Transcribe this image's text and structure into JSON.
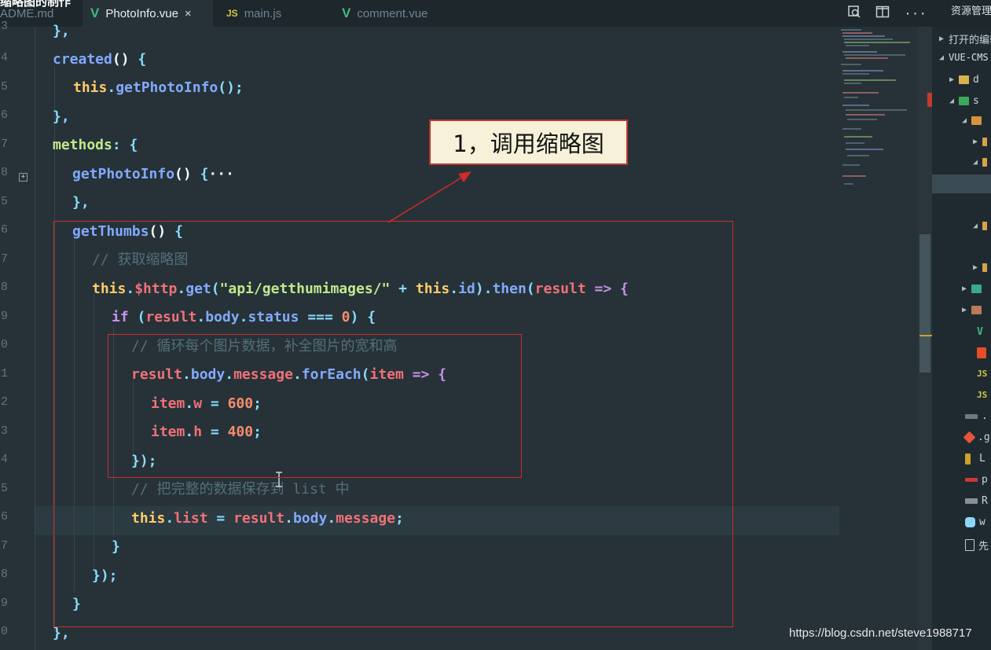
{
  "window": {
    "ghost_title": "缩略图的制作"
  },
  "tabs": [
    {
      "icon": "",
      "label": "ADME.md",
      "active": false
    },
    {
      "icon": "V",
      "label": "PhotoInfo.vue",
      "active": true,
      "close": "×"
    },
    {
      "icon": "JS",
      "label": "main.js",
      "active": false
    },
    {
      "icon": "V",
      "label": "comment.vue",
      "active": false
    }
  ],
  "toolbar": {
    "icons": [
      "open-changes-icon",
      "split-editor-icon",
      "more-actions-icon"
    ],
    "more": "···"
  },
  "explorer": {
    "header": "资源管理器",
    "open_editors": "打开的编辑器",
    "root": "VUE-CMS",
    "items": [
      "d",
      "s",
      "",
      "",
      "",
      "",
      "",
      "",
      "",
      "",
      "",
      "",
      "",
      "",
      "",
      ".",
      ".g",
      "L",
      "p",
      "R",
      "w",
      "先"
    ]
  },
  "line_numbers": [
    "3",
    "4",
    "5",
    "6",
    "7",
    "8",
    "5",
    "6",
    "7",
    "8",
    "9",
    "0",
    "1",
    "2",
    "3",
    "4",
    "5",
    "6",
    "7",
    "8",
    "9",
    "0"
  ],
  "code": {
    "l0": [
      "},"
    ],
    "l1": [
      "created",
      "()",
      " {"
    ],
    "l2": [
      "this",
      ".",
      "getPhotoInfo",
      "();"
    ],
    "l3": [
      "},"
    ],
    "l4": [
      "methods",
      ": {"
    ],
    "l5": [
      "getPhotoInfo",
      "()",
      " {",
      "···"
    ],
    "l6": [
      "},"
    ],
    "l7": [
      "getThumbs",
      "()",
      " {"
    ],
    "l8": [
      "// 获取缩略图"
    ],
    "l9": [
      "this",
      ".",
      "$http",
      ".",
      "get",
      "(",
      "\"api/getthumimages/\"",
      " + ",
      "this",
      ".",
      "id",
      ").",
      "then",
      "(",
      "result",
      " => {"
    ],
    "l10": [
      "if",
      " (",
      "result",
      ".",
      "body",
      ".",
      "status",
      " === ",
      "0",
      ") {"
    ],
    "l11": [
      "// 循环每个图片数据，补全图片的宽和高"
    ],
    "l12": [
      "result",
      ".",
      "body",
      ".",
      "message",
      ".",
      "forEach",
      "(",
      "item",
      " => {"
    ],
    "l13": [
      "item",
      ".",
      "w",
      " = ",
      "600",
      ";"
    ],
    "l14": [
      "item",
      ".",
      "h",
      " = ",
      "400",
      ";"
    ],
    "l15": [
      "});"
    ],
    "l16": [
      "// 把完整的数据保存到 list 中"
    ],
    "l17": [
      "this",
      ".",
      "list",
      " = ",
      "result",
      ".",
      "body",
      ".",
      "message",
      ";"
    ],
    "l18": [
      "}"
    ],
    "l19": [
      "});"
    ],
    "l20": [
      "}"
    ],
    "l21": [
      "},"
    ]
  },
  "annotation": {
    "callout": "1，调用缩略图"
  },
  "watermark": "https://blog.csdn.net/steve1988717",
  "colors": {
    "editor_bg": "#263238",
    "annotation_red": "#d02a2a",
    "callout_bg": "#f6f1d8"
  }
}
